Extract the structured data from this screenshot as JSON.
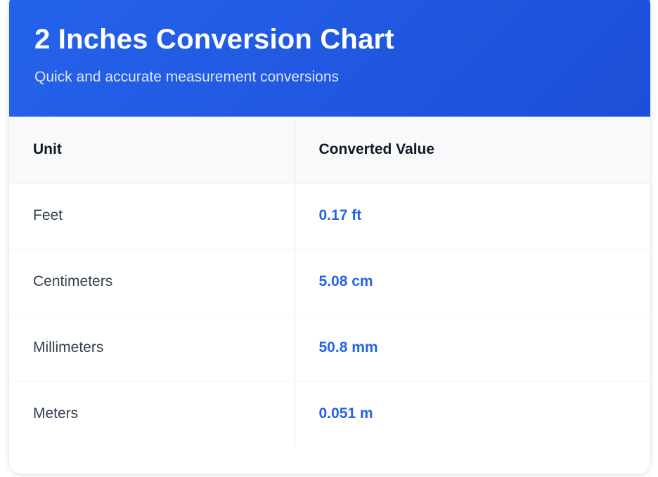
{
  "header": {
    "title": "2 Inches Conversion Chart",
    "subtitle": "Quick and accurate measurement conversions"
  },
  "table": {
    "columns": [
      "Unit",
      "Converted Value"
    ],
    "rows": [
      {
        "unit": "Feet",
        "value": "0.17 ft"
      },
      {
        "unit": "Centimeters",
        "value": "5.08 cm"
      },
      {
        "unit": "Millimeters",
        "value": "50.8 mm"
      },
      {
        "unit": "Meters",
        "value": "0.051 m"
      }
    ]
  },
  "colors": {
    "header_gradient_start": "#2563eb",
    "header_gradient_end": "#1d4ed8",
    "value_text": "#2563eb",
    "header_row_bg": "#f8f9fb"
  }
}
